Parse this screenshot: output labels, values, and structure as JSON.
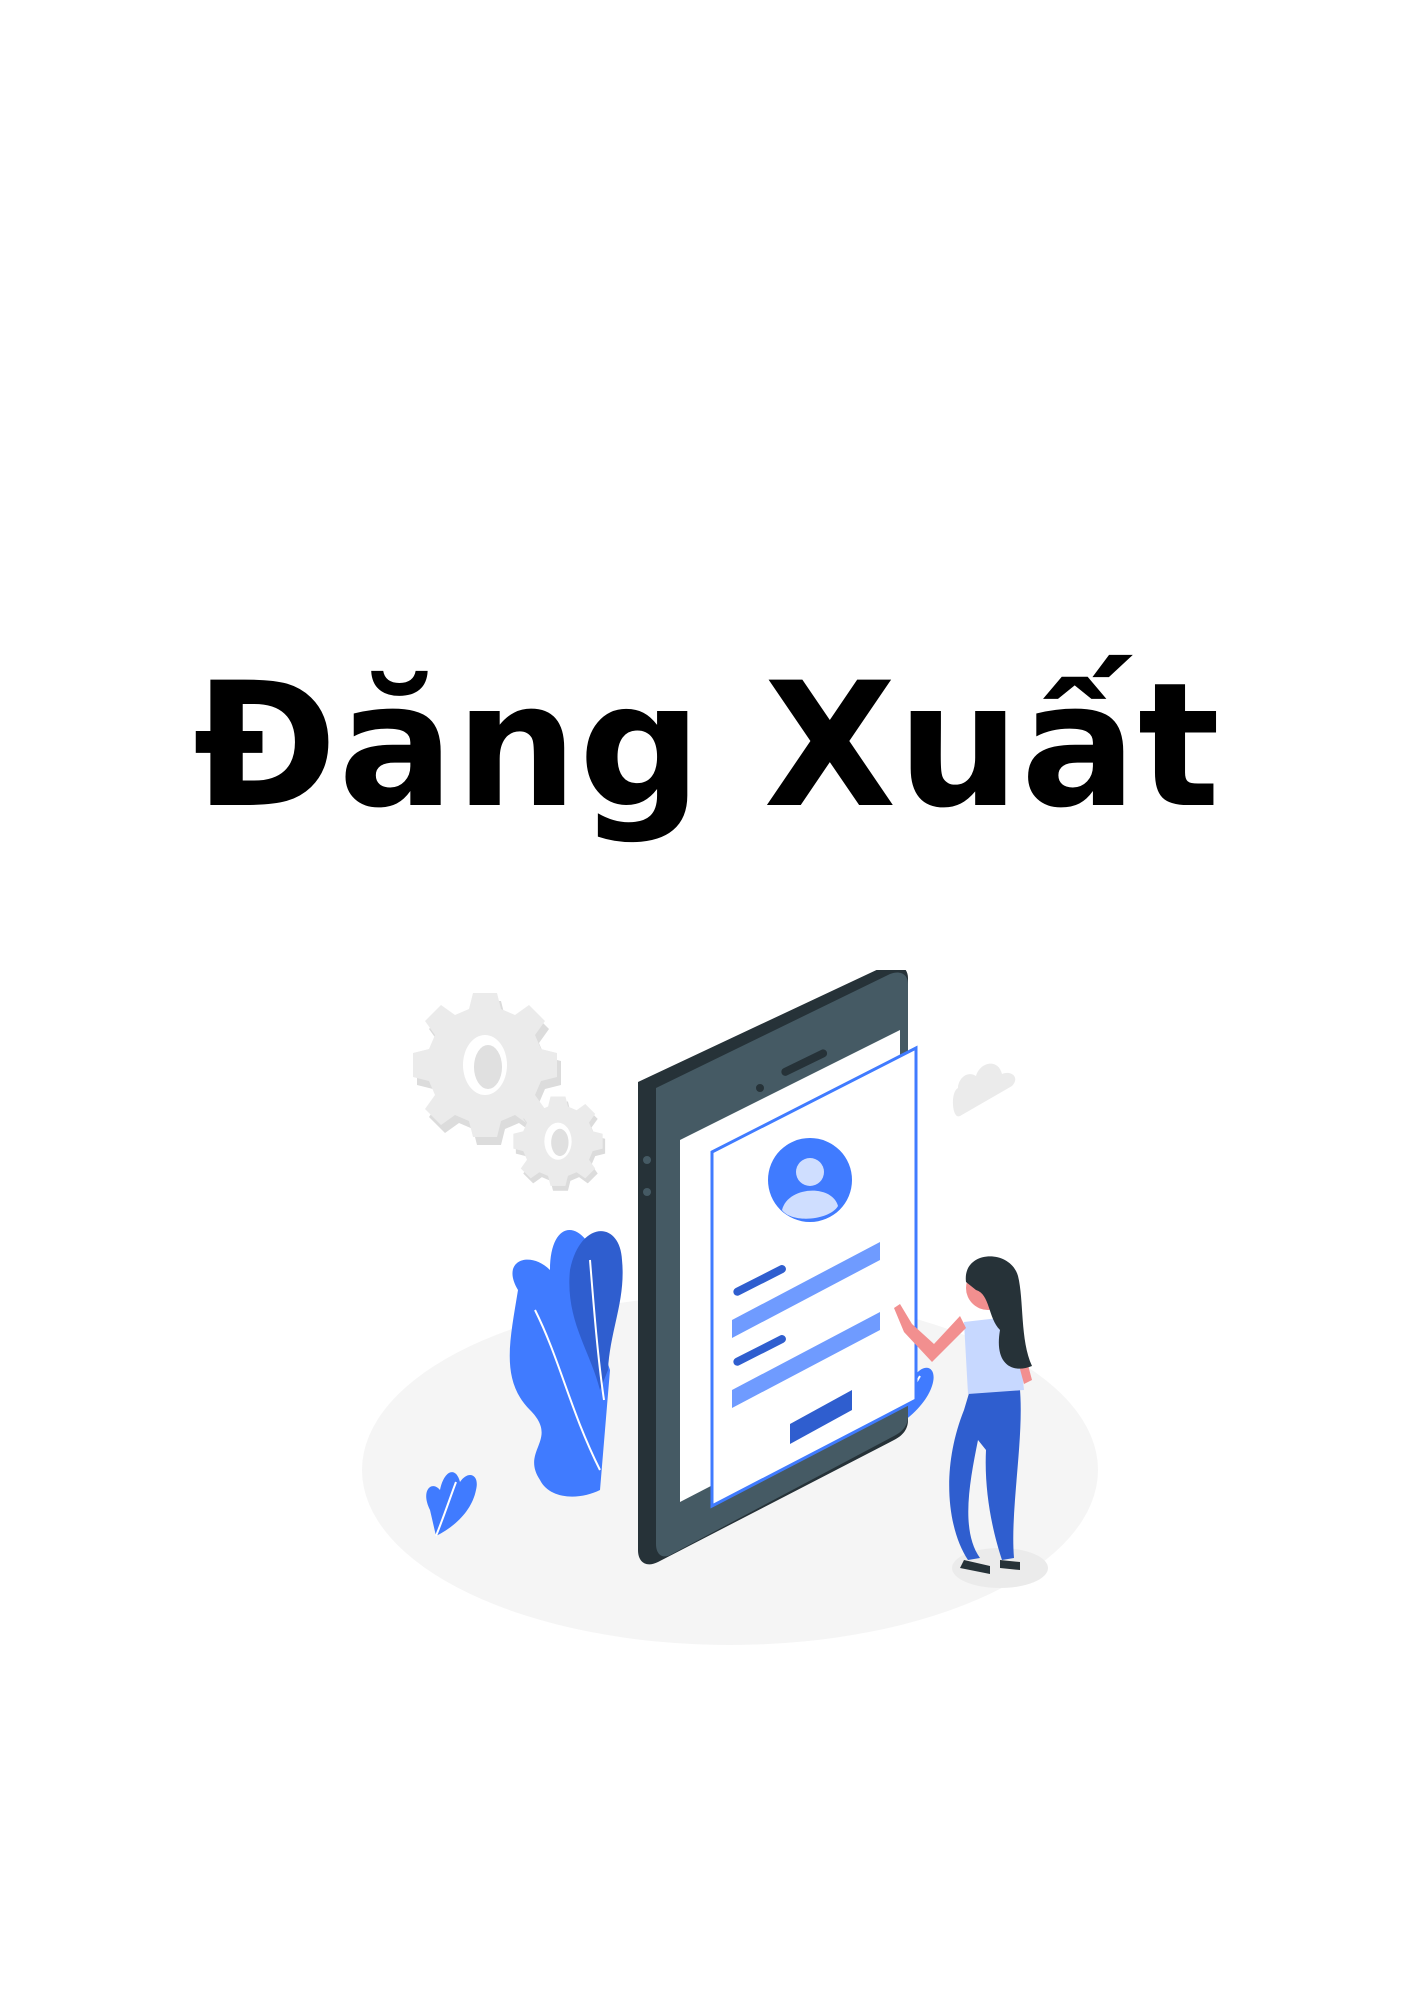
{
  "page": {
    "title": "Đăng Xuất"
  },
  "colors": {
    "background": "#ffffff",
    "title_text": "#000000",
    "accent_blue": "#407bff",
    "dark_blue": "#2f5ecf",
    "phone_dark": "#263238",
    "phone_body": "#455a64",
    "ground_gray": "#f5f5f5",
    "gear_gray": "#e0e0e0",
    "skin": "#f28f8f",
    "hair": "#263238"
  },
  "illustration": {
    "icons": [
      "gear-icon",
      "cloud-icon",
      "smartphone-icon",
      "user-avatar-icon",
      "plant-icon",
      "woman-figure"
    ]
  }
}
